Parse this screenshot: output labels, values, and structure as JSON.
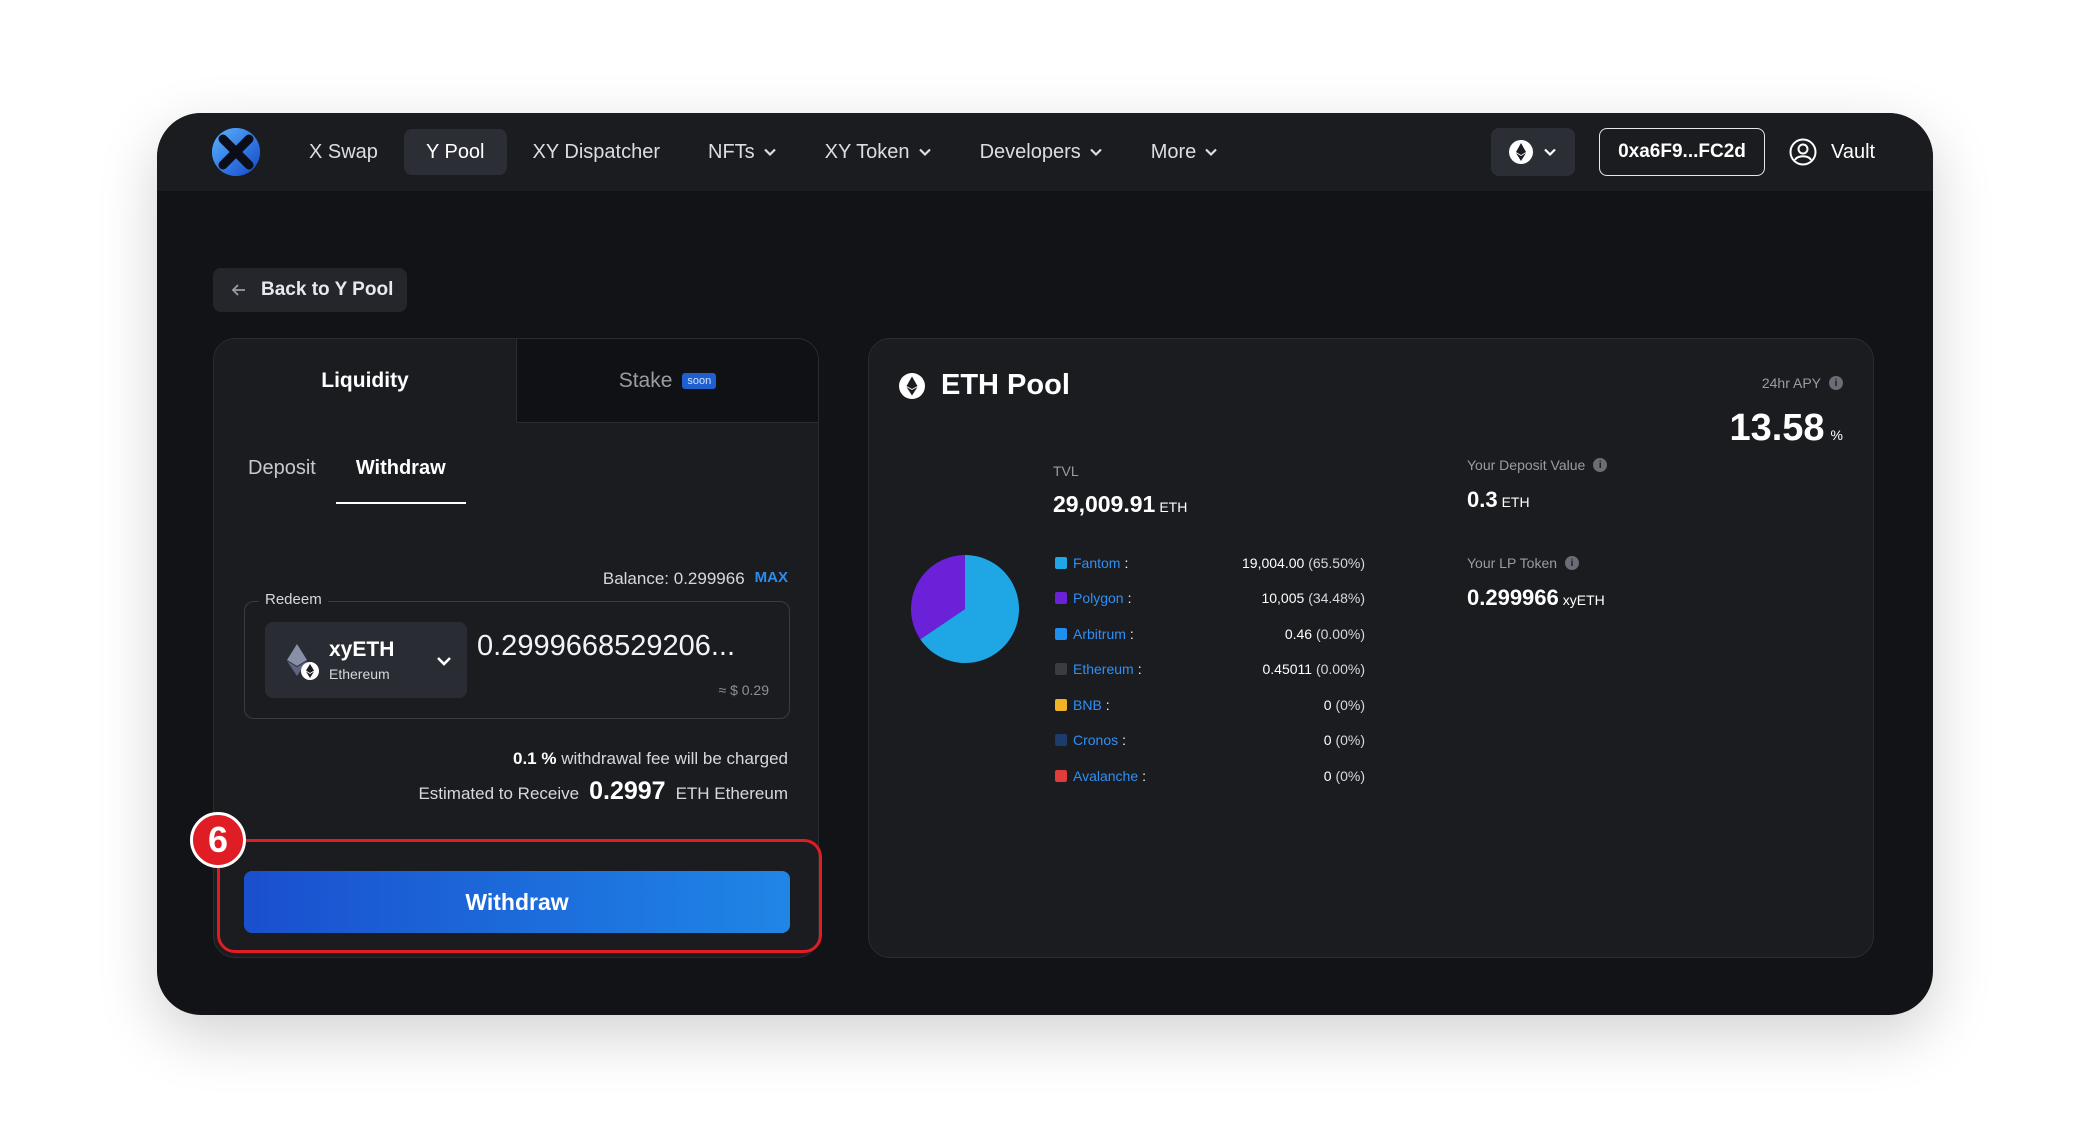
{
  "nav": {
    "items": [
      {
        "label": "X Swap",
        "active": false,
        "dropdown": false
      },
      {
        "label": "Y Pool",
        "active": true,
        "dropdown": false
      },
      {
        "label": "XY Dispatcher",
        "active": false,
        "dropdown": false
      },
      {
        "label": "NFTs",
        "active": false,
        "dropdown": true
      },
      {
        "label": "XY Token",
        "active": false,
        "dropdown": true
      },
      {
        "label": "Developers",
        "active": false,
        "dropdown": true
      },
      {
        "label": "More",
        "active": false,
        "dropdown": true
      }
    ],
    "wallet_address": "0xa6F9...FC2d",
    "vault_label": "Vault",
    "chain_icon": "ethereum-icon"
  },
  "back_button": {
    "label": "Back to Y Pool"
  },
  "left_panel": {
    "tabs": {
      "liquidity": "Liquidity",
      "stake": "Stake",
      "stake_badge": "soon"
    },
    "subtabs": {
      "deposit": "Deposit",
      "withdraw": "Withdraw"
    },
    "balance_label": "Balance: 0.299966",
    "max_label": "MAX",
    "redeem": {
      "label": "Redeem",
      "token_name": "xyETH",
      "token_chain": "Ethereum",
      "amount": "0.2999668529206...",
      "usd_value": "≈ $ 0.29"
    },
    "fee_percent": "0.1 %",
    "fee_text": "withdrawal fee will be charged",
    "estimate_label": "Estimated to Receive",
    "estimate_value": "0.2997",
    "estimate_unit": "ETH Ethereum",
    "withdraw_button": "Withdraw"
  },
  "annotation": {
    "step_number": "6",
    "highlight_color": "#e01c24"
  },
  "right_panel": {
    "pool_title": "ETH Pool",
    "apy_label": "24hr APY",
    "apy_value": "13.58",
    "apy_unit": "%",
    "tvl_label": "TVL",
    "tvl_value": "29,009.91",
    "tvl_unit": "ETH",
    "deposit_label": "Your Deposit Value",
    "deposit_value": "0.3",
    "deposit_unit": "ETH",
    "lp_label": "Your LP Token",
    "lp_value": "0.299966",
    "lp_unit": "xyETH"
  },
  "chart_data": {
    "type": "pie",
    "title": "",
    "categories": [
      "Fantom",
      "Polygon",
      "Arbitrum",
      "Ethereum",
      "BNB",
      "Cronos",
      "Avalanche"
    ],
    "values": [
      65.5,
      34.48,
      0.0,
      0.0,
      0,
      0,
      0
    ],
    "amounts": [
      "19,004.00",
      "10,005",
      "0.46",
      "0.45011",
      "0",
      "0",
      "0"
    ],
    "percent_labels": [
      "(65.50%)",
      "(34.48%)",
      "(0.00%)",
      "(0.00%)",
      "(0%)",
      "(0%)",
      "(0%)"
    ],
    "colors": [
      "#1ea7e4",
      "#6b21d8",
      "#1c8ff0",
      "#3a3c42",
      "#f0b323",
      "#1b3c6d",
      "#e23b3b"
    ],
    "legend": "right"
  }
}
